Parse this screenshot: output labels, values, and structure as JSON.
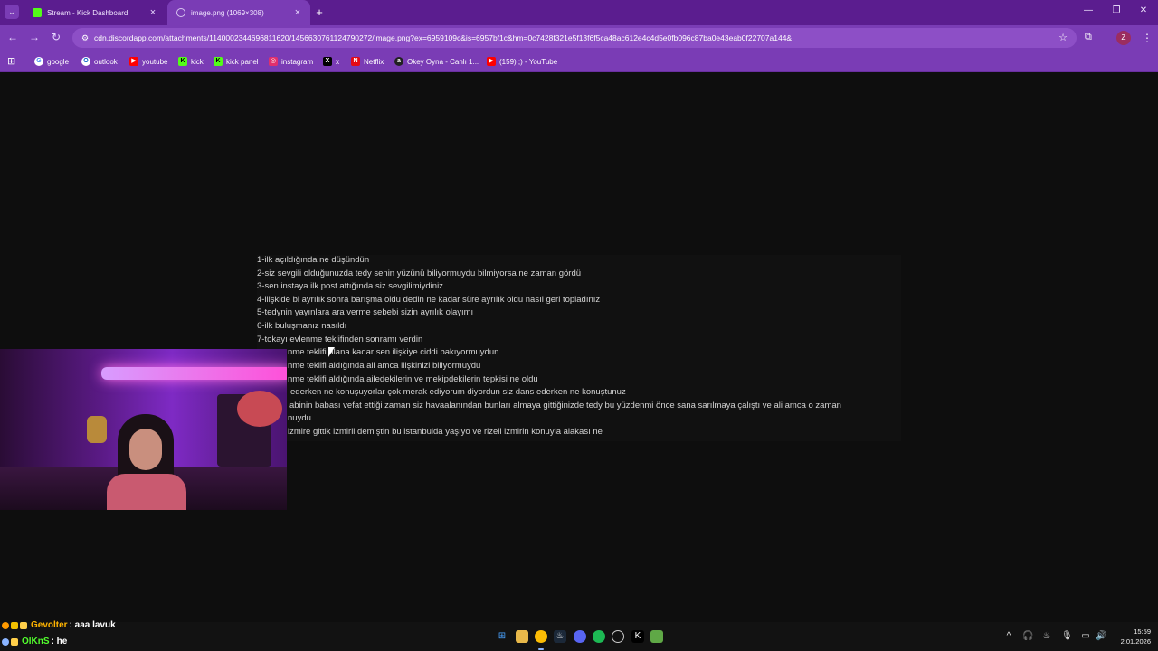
{
  "browser": {
    "tabs": [
      {
        "title": "Stream - Kick Dashboard",
        "favicon": "kick-icon",
        "color": "#53fc18"
      },
      {
        "title": "image.png (1069×308)",
        "favicon": "globe-icon",
        "active": true
      }
    ],
    "url": "cdn.discordapp.com/attachments/1140002344696811620/1456630761124790272/image.png?ex=6959109c&is=6957bf1c&hm=0c7428f321e5f13f6f5ca48ac612e4c4d5e0fb096c87ba0e43eab0f22707a144&",
    "profile_initial": "Z",
    "accent": "#7a3cb5"
  },
  "bookmarks": [
    {
      "label": "google",
      "icon": "google-icon",
      "color": "#4285f4"
    },
    {
      "label": "outlook",
      "icon": "outlook-icon",
      "color": "#0a64c8"
    },
    {
      "label": "youtube",
      "icon": "youtube-icon",
      "color": "#ff0000"
    },
    {
      "label": "kick",
      "icon": "kick-icon",
      "color": "#53fc18"
    },
    {
      "label": "kick panel",
      "icon": "kick-icon",
      "color": "#53fc18"
    },
    {
      "label": "instagram",
      "icon": "instagram-icon",
      "color": "#e1306c"
    },
    {
      "label": "x",
      "icon": "x-icon",
      "color": "#000000"
    },
    {
      "label": "Netflix",
      "icon": "netflix-icon",
      "color": "#e50914"
    },
    {
      "label": "Okey Oyna - Canlı 1...",
      "icon": "okey-icon",
      "color": "#222222"
    },
    {
      "label": "(159) ;) - YouTube",
      "icon": "youtube-icon",
      "color": "#ff0000"
    }
  ],
  "image_lines": [
    "1-ilk açıldığında ne düşündün",
    "2-siz sevgili olduğunuzda tedy senin yüzünü biliyormuydu bilmiyorsa ne zaman gördü",
    "3-sen instaya ilk post attığında siz sevgilimiydiniz",
    "4-ilişkide bi ayrılık sonra barışma oldu dedin ne kadar süre ayrılık oldu nasıl geri topladınız",
    "5-tedynin yayınlara ara verme sebebi sizin ayrılık olayımı",
    "6-ilk buluşmanız nasıldı",
    "7-tokayı evlenme teklifinden sonramı verdin",
    "nme teklifi alana kadar sen ilişkiye ciddi bakıyormuydun",
    "nme teklifi aldığında ali amca ilişkinizi biliyormuydu",
    "nme teklifi aldığında ailedekilerin ve mekipdekilerin tepkisi ne oldu",
    "ederken ne konuşuyorlar çok merak ediyorum diyordun siz dans ederken ne konuştunuz",
    "abinin babası vefat ettiği zaman siz havaalanından bunları almaya gittiğinizde tedy bu yüzdenmi önce sana sarılmaya çalıştı ve ali amca o zaman",
    "nuydu",
    "izmire gittik izmirli demiştin bu istanbulda yaşıyo ve rizeli izmirin konuyla alakası ne"
  ],
  "chat": [
    {
      "user": "Gevolter",
      "message": ": aaa lavuk",
      "user_color": "#ffb400"
    },
    {
      "user": "OlKnS",
      "message": ": he",
      "user_color": "#52ff2d"
    }
  ],
  "taskbar": {
    "apps": [
      "windows-icon",
      "file-explorer-icon",
      "chrome-icon",
      "steam-icon",
      "discord-icon",
      "spotify-icon",
      "obs-icon",
      "kick-studio-icon",
      "minecraft-icon"
    ],
    "time": "15:59",
    "date": "2.01.2026"
  }
}
